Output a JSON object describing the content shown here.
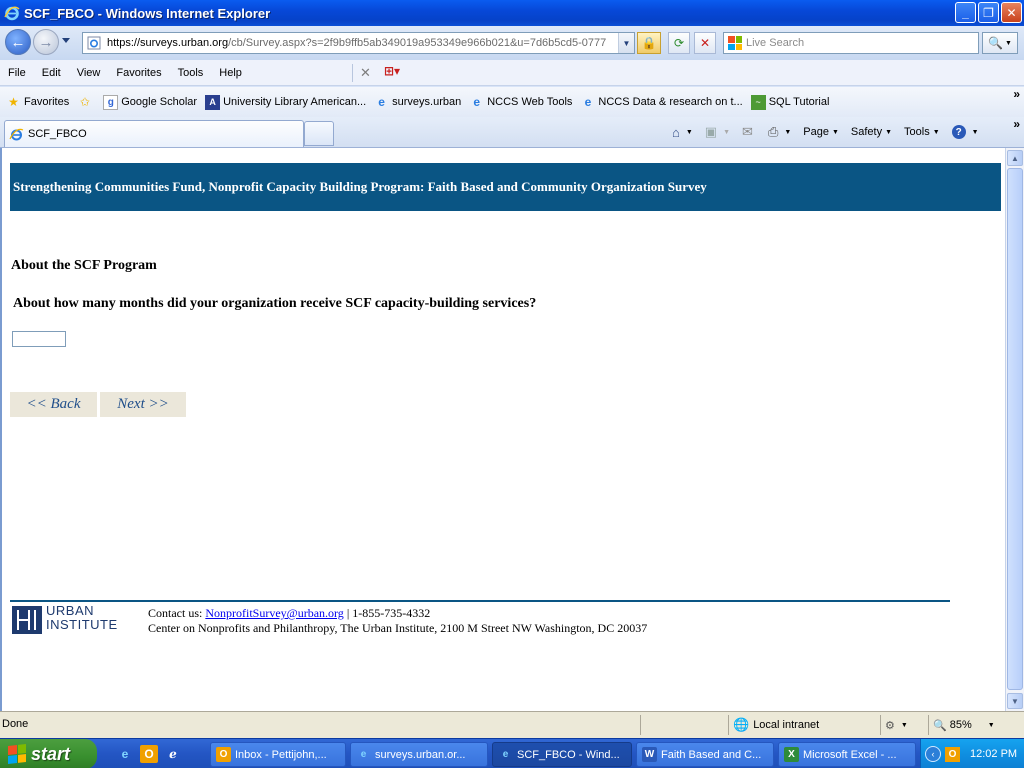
{
  "window": {
    "title": "SCF_FBCO - Windows Internet Explorer",
    "controls": {
      "minimize": "_",
      "maximize": "❐",
      "close": "✕"
    }
  },
  "address": {
    "protocol": "https://",
    "host": "surveys.urban.org",
    "path": "/cb/Survey.aspx?s=2f9b9ffb5ab349019a953349e966b021&u=7d6b5cd5-0777",
    "search_placeholder": "Live Search"
  },
  "menu": [
    "File",
    "Edit",
    "View",
    "Favorites",
    "Tools",
    "Help"
  ],
  "favorites_bar": {
    "favorites_label": "Favorites",
    "items": [
      {
        "label": "Google Scholar",
        "icon": "google-icon"
      },
      {
        "label": "University Library  American...",
        "icon": "university-icon"
      },
      {
        "label": "surveys.urban",
        "icon": "ie-page-icon"
      },
      {
        "label": "NCCS Web Tools",
        "icon": "ie-page-icon"
      },
      {
        "label": "NCCS  Data & research on t...",
        "icon": "ie-page-icon"
      },
      {
        "label": "SQL Tutorial",
        "icon": "sql-icon"
      }
    ],
    "more": "»"
  },
  "tabs": {
    "active_label": "SCF_FBCO",
    "commands": [
      "Page",
      "Safety",
      "Tools"
    ]
  },
  "page": {
    "banner": "Strengthening Communities Fund, Nonprofit Capacity Building Program: Faith Based and Community Organization Survey",
    "section_title": "About the SCF Program",
    "question": "About how many months did your organization receive SCF capacity-building services?",
    "answer_value": "",
    "back_label": "<< Back",
    "next_label": "Next >>",
    "footer": {
      "logo_line1": "URBAN",
      "logo_line2": "INSTITUTE",
      "contact_prefix": "Contact us: ",
      "contact_email": "NonprofitSurvey@urban.org",
      "contact_phone": " | 1-855-735-4332",
      "address": "Center on Nonprofits and Philanthropy, The Urban Institute, 2100 M Street NW Washington, DC 20037"
    }
  },
  "statusbar": {
    "status": "Done",
    "zone": "Local intranet",
    "zoom": "85%"
  },
  "taskbar": {
    "start_label": "start",
    "tasks": [
      {
        "label": "Inbox - Pettijohn,...",
        "icon": "outlook-icon"
      },
      {
        "label": "surveys.urban.or...",
        "icon": "ie-page-icon"
      },
      {
        "label": "SCF_FBCO - Wind...",
        "icon": "ie-page-icon"
      },
      {
        "label": "Faith Based and C...",
        "icon": "word-icon"
      },
      {
        "label": "Microsoft Excel - ...",
        "icon": "excel-icon"
      }
    ],
    "clock": "12:02 PM"
  },
  "colors": {
    "banner_bg": "#0a5584",
    "nav_button_bg": "#ebe7da",
    "nav_button_text": "#1f4e8a"
  }
}
